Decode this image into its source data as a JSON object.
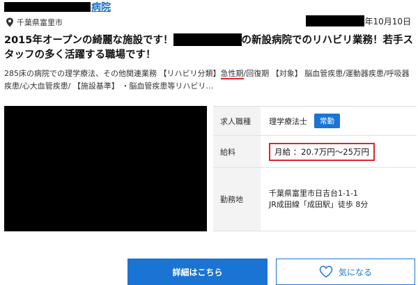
{
  "facility": {
    "name_suffix": "病院"
  },
  "post": {
    "date_suffix": "年10月10日",
    "location": "千葉県富里市",
    "headline_part1": "2015年オープンの綺麗な施設です！",
    "headline_part2": "の新設病院でのリハビリ業務！若手スタッフの多く活躍する職場です！",
    "summary_part1": "285床の病院での理学療法、その他関連業務 【リハビリ分類】",
    "summary_highlight": "急性期",
    "summary_part2": "/回復期 【対象】 脳血管疾患/運動器疾患/呼吸器疾患/心大血管疾患/ 【施設基準】 ・脳血管疾患等リハビリ…"
  },
  "details": {
    "job_type_label": "求人職種",
    "job_type_value": "理学療法士",
    "employment_badge": "常勤",
    "salary_label": "給料",
    "salary_value": "月給 ：20.7万円～25万円",
    "location_label": "勤務地",
    "address_line1": "千葉県富里市日吉台1-1-1",
    "address_line2": "JR成田線「成田駅」徒歩 8分"
  },
  "actions": {
    "detail_button": "詳細はこちら",
    "favorite_button": "気になる"
  },
  "colors": {
    "accent": "#1a74d4",
    "highlight": "#d9262c"
  }
}
